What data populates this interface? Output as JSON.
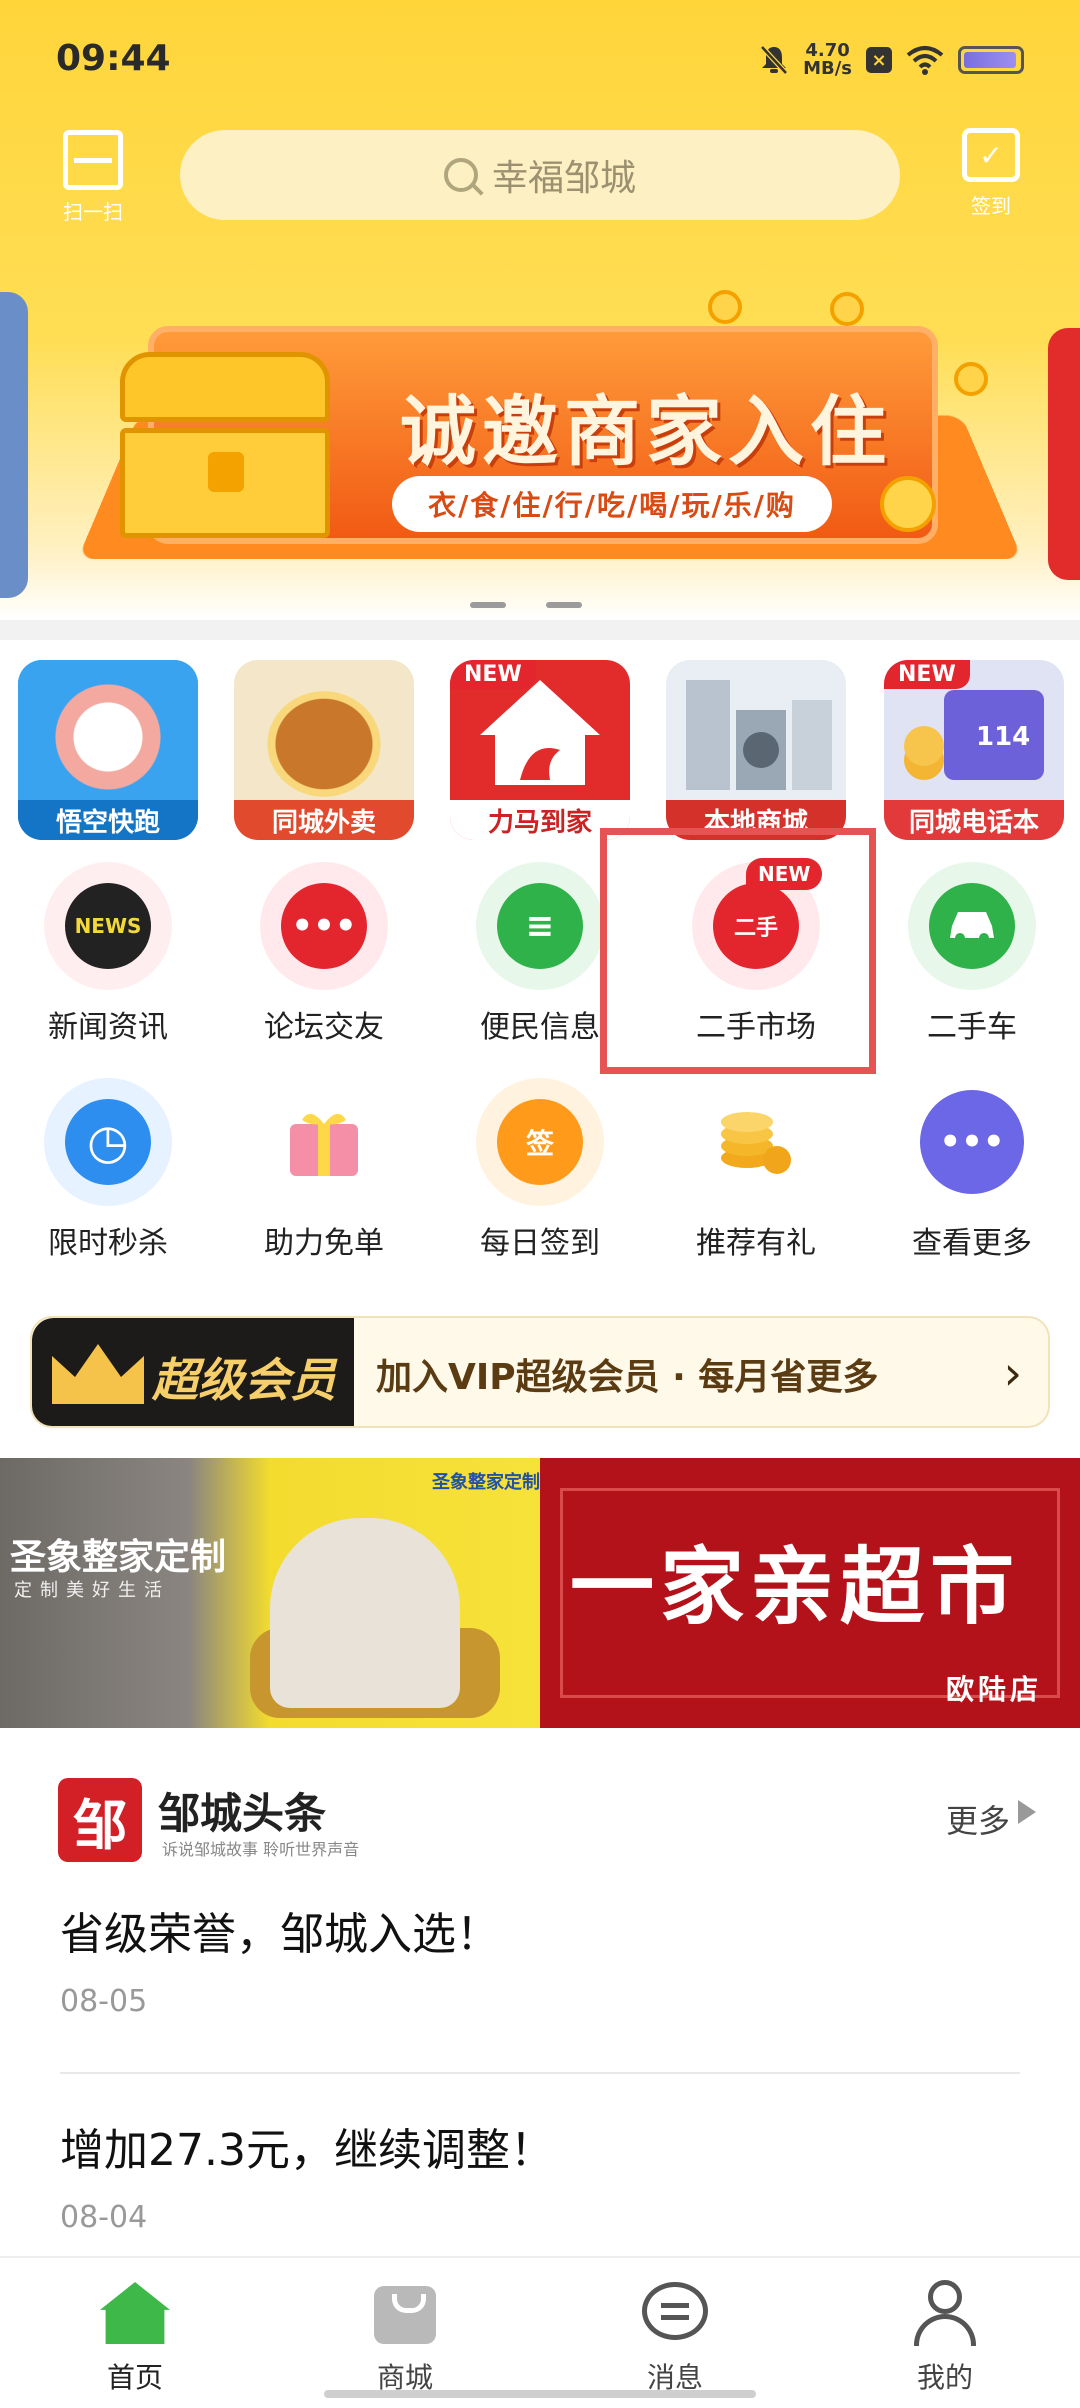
{
  "status_bar": {
    "time": "09:44",
    "net_speed_value": "4.70",
    "net_speed_unit": "MB/s",
    "x_badge": "×"
  },
  "header": {
    "scan_label": "扫一扫",
    "search_placeholder": "幸福邹城",
    "sign_label": "签到",
    "sign_icon_glyph": "✓"
  },
  "banner": {
    "title": "诚邀商家入住",
    "subtitle": "衣/食/住/行/吃/喝/玩/乐/购",
    "page_count": 2
  },
  "app_tiles": [
    {
      "label": "悟空快跑",
      "new": false,
      "color": "#1f8ee0"
    },
    {
      "label": "同城外卖",
      "new": false,
      "color": "#e24a2e"
    },
    {
      "label": "力马到家",
      "new": true,
      "color": "#e22b2b"
    },
    {
      "label": "本地商城",
      "new": false,
      "color": "#d4312a"
    },
    {
      "label": "同城电话本",
      "new": true,
      "color": "#e23a3a"
    }
  ],
  "new_badge_text": "NEW",
  "tile_number": "114",
  "grid_row1": [
    {
      "label": "新闻资讯",
      "icon": "news-icon",
      "color": "#222",
      "glyph": "NEWS"
    },
    {
      "label": "论坛交友",
      "icon": "chat-dots-icon",
      "color": "#e3262e",
      "glyph": "•••"
    },
    {
      "label": "便民信息",
      "icon": "document-icon",
      "color": "#2fb24a",
      "glyph": "≡"
    },
    {
      "label": "二手市场",
      "icon": "secondhand-box-icon",
      "color": "#e3262e",
      "glyph": "二手",
      "new": true
    },
    {
      "label": "二手车",
      "icon": "car-icon",
      "color": "#2fb24a",
      "glyph": "🚗"
    }
  ],
  "grid_row2": [
    {
      "label": "限时秒杀",
      "icon": "alarm-clock-icon",
      "color": "#2d8ef0",
      "glyph": "◷"
    },
    {
      "label": "助力免单",
      "icon": "gift-icon",
      "color": "#f37a9a",
      "glyph": "🎁"
    },
    {
      "label": "每日签到",
      "icon": "calendar-sign-icon",
      "color": "#ff9a1a",
      "glyph": "签"
    },
    {
      "label": "推荐有礼",
      "icon": "coins-icon",
      "color": "#f5b629",
      "glyph": "◉"
    },
    {
      "label": "查看更多",
      "icon": "more-dots-icon",
      "color": "#6b67e6",
      "glyph": "•••"
    }
  ],
  "vip": {
    "title": "超级会员",
    "text": "加入VIP超级会员 · 每月省更多",
    "arrow": "›"
  },
  "ads": {
    "left_title": "圣象整家定制",
    "left_subtitle": "定制美好生活",
    "left_brand": "圣象整家定制",
    "right_title": "一家亲超市",
    "right_subtitle": "欧陆店"
  },
  "news": {
    "logo_char": "邹",
    "brand": "邹城头条",
    "slogan": "诉说邹城故事 聆听世界声音",
    "more": "更多",
    "items": [
      {
        "title": "省级荣誉，邹城入选！",
        "date": "08-05"
      },
      {
        "title": "增加27.3元，继续调整！",
        "date": "08-04"
      }
    ]
  },
  "bottom_nav": [
    {
      "label": "首页",
      "icon": "home-icon",
      "active": true
    },
    {
      "label": "商城",
      "icon": "shopping-bag-icon",
      "active": false
    },
    {
      "label": "消息",
      "icon": "message-icon",
      "active": false
    },
    {
      "label": "我的",
      "icon": "user-icon",
      "active": false
    }
  ]
}
